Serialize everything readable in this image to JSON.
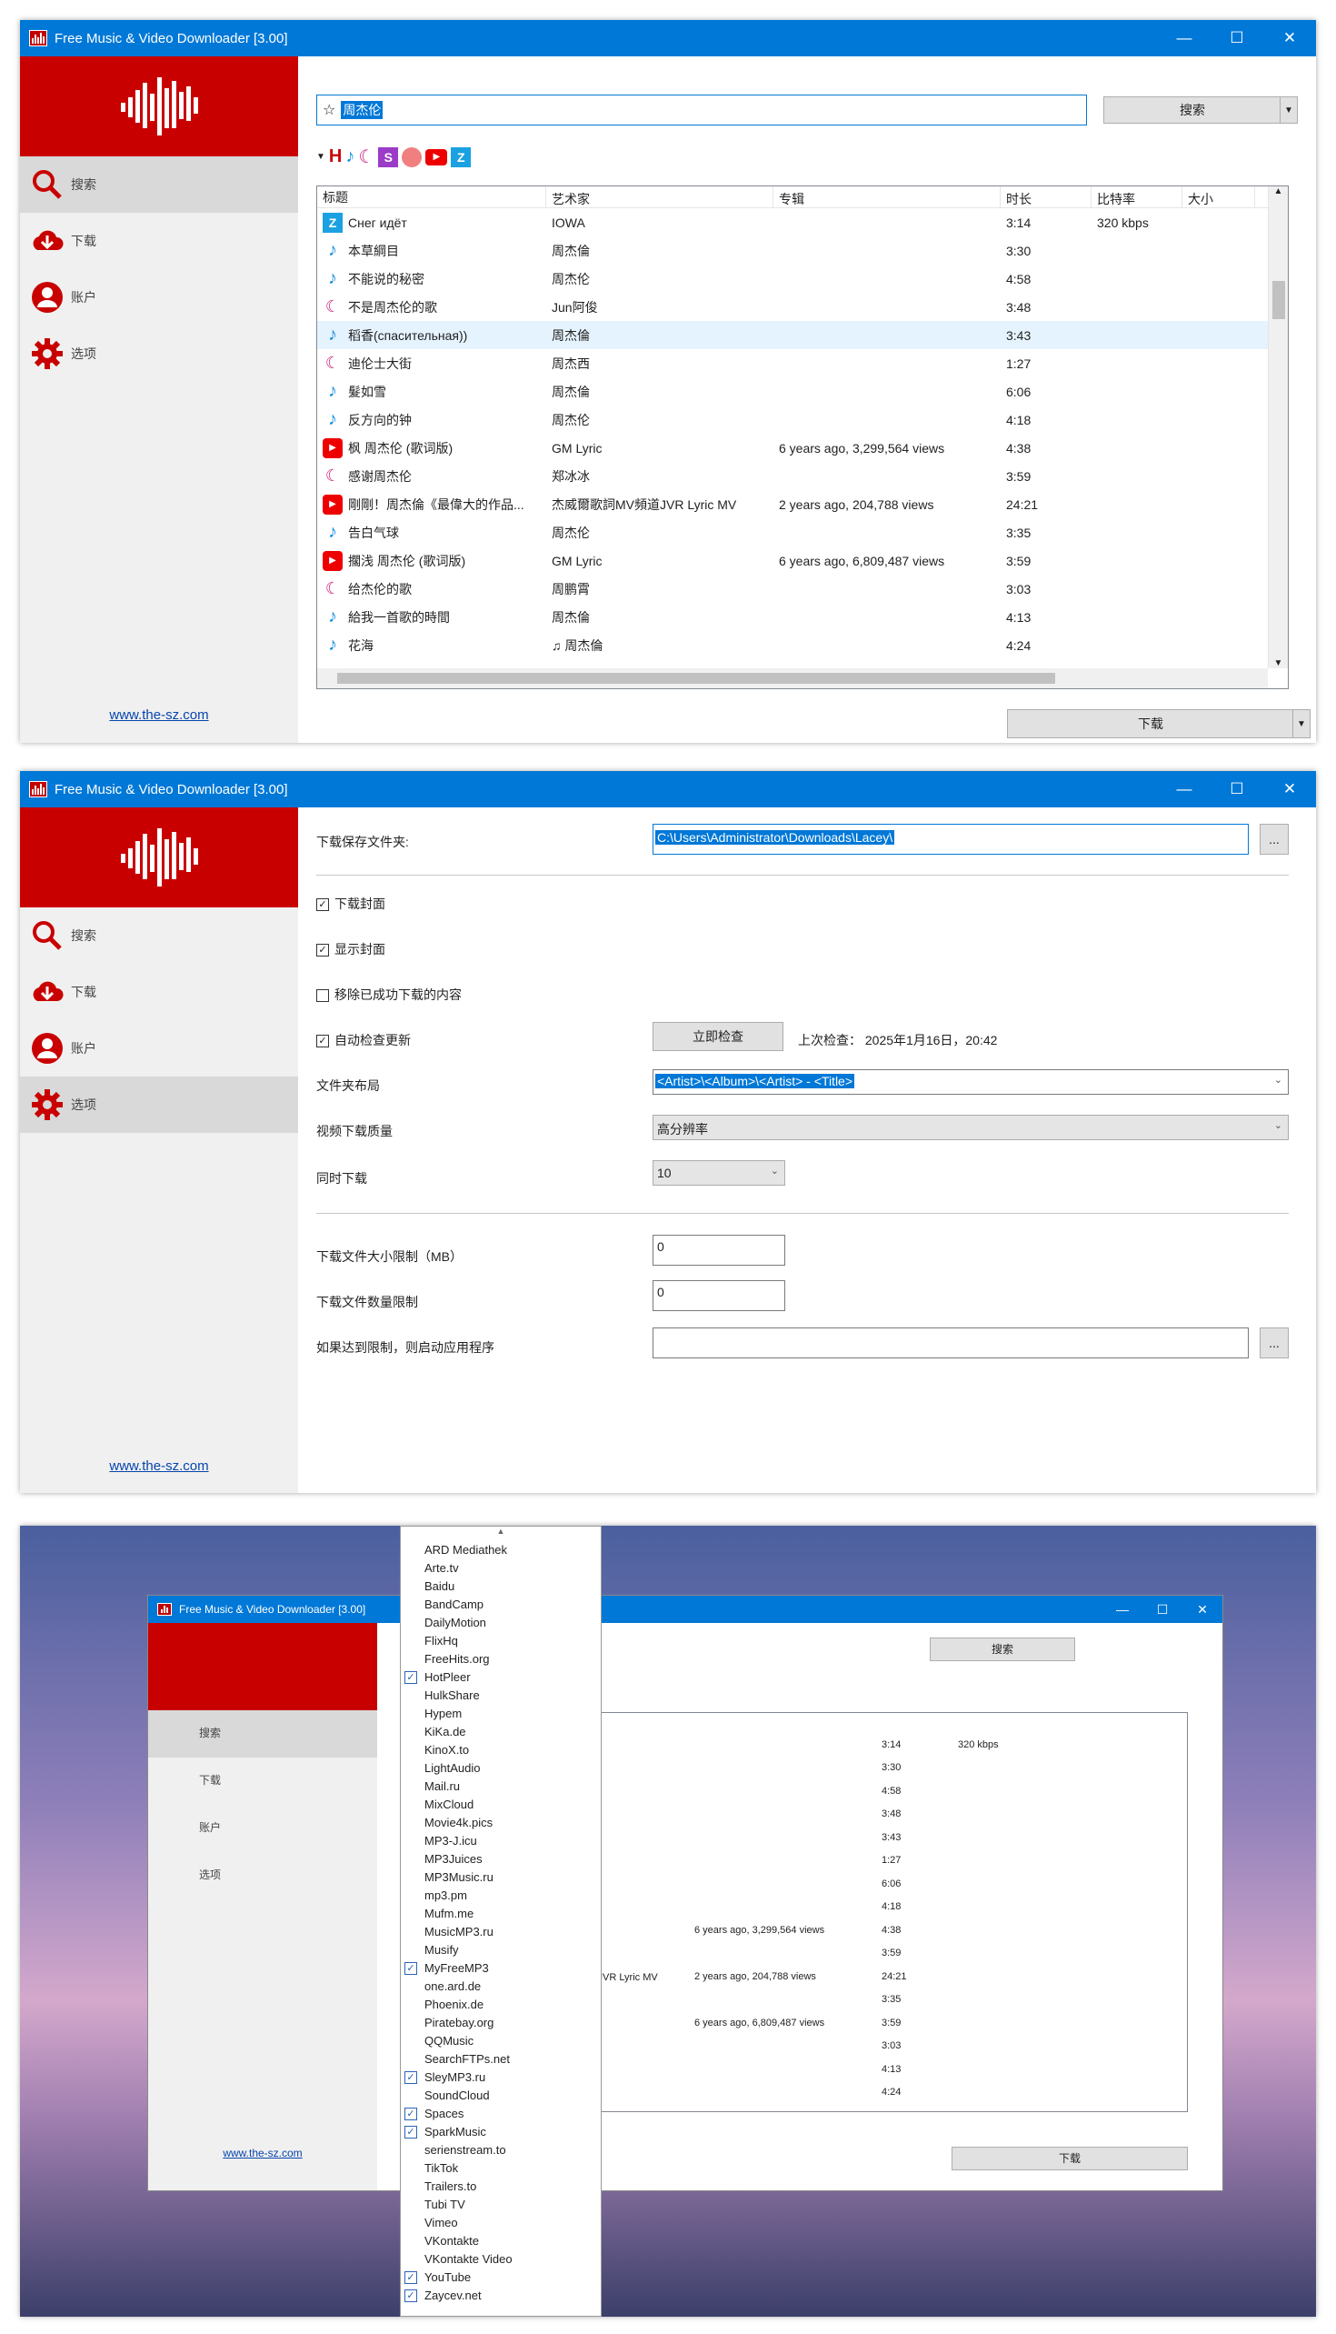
{
  "app": {
    "title": "Free Music & Video Downloader [3.00]",
    "site_link": "www.the-sz.com"
  },
  "nav": [
    {
      "label": "搜索",
      "icon": "search-icon"
    },
    {
      "label": "下载",
      "icon": "cloud-download-icon"
    },
    {
      "label": "账户",
      "icon": "account-icon"
    },
    {
      "label": "选项",
      "icon": "gear-icon"
    }
  ],
  "search": {
    "query": "周杰伦",
    "button": "搜索"
  },
  "table": {
    "columns": [
      "标题",
      "艺术家",
      "专辑",
      "时长",
      "比特率",
      "大小"
    ],
    "rows": [
      {
        "src": "Z",
        "title": "Снег идёт",
        "artist": "IOWA",
        "album": "",
        "dur": "3:14",
        "bitrate": "320 kbps"
      },
      {
        "src": "note",
        "title": "本草綱目",
        "artist": "周杰倫",
        "album": "",
        "dur": "3:30",
        "bitrate": ""
      },
      {
        "src": "note",
        "title": "不能说的秘密",
        "artist": "周杰伦",
        "album": "",
        "dur": "4:58",
        "bitrate": ""
      },
      {
        "src": "c",
        "title": "不是周杰伦的歌",
        "artist": "Jun阿俊",
        "album": "",
        "dur": "3:48",
        "bitrate": ""
      },
      {
        "src": "note",
        "title": "稻香(спасительная))",
        "artist": "周杰倫",
        "album": "",
        "dur": "3:43",
        "bitrate": ""
      },
      {
        "src": "c",
        "title": "迪伦士大街",
        "artist": "周杰西",
        "album": "",
        "dur": "1:27",
        "bitrate": ""
      },
      {
        "src": "note",
        "title": "髮如雪",
        "artist": "周杰倫",
        "album": "",
        "dur": "6:06",
        "bitrate": ""
      },
      {
        "src": "note",
        "title": "反方向的钟",
        "artist": "周杰伦",
        "album": "",
        "dur": "4:18",
        "bitrate": ""
      },
      {
        "src": "yt",
        "title": "枫 周杰伦 (歌词版)",
        "artist": "GM Lyric",
        "album": "6 years ago, 3,299,564 views",
        "dur": "4:38",
        "bitrate": ""
      },
      {
        "src": "c",
        "title": "感谢周杰伦",
        "artist": "郑冰冰",
        "album": "",
        "dur": "3:59",
        "bitrate": ""
      },
      {
        "src": "yt",
        "title": "剛剛！周杰倫《最偉大的作品...",
        "artist": "杰威爾歌詞MV頻道JVR Lyric MV",
        "album": "2 years ago, 204,788 views",
        "dur": "24:21",
        "bitrate": ""
      },
      {
        "src": "note",
        "title": "告白气球",
        "artist": "周杰伦",
        "album": "",
        "dur": "3:35",
        "bitrate": ""
      },
      {
        "src": "yt",
        "title": "擱浅 周杰伦 (歌词版)",
        "artist": "GM Lyric",
        "album": "6 years ago, 6,809,487 views",
        "dur": "3:59",
        "bitrate": ""
      },
      {
        "src": "c",
        "title": "给杰伦的歌",
        "artist": "周鹏霄",
        "album": "",
        "dur": "3:03",
        "bitrate": ""
      },
      {
        "src": "note",
        "title": "給我一首歌的時間",
        "artist": "周杰倫",
        "album": "",
        "dur": "4:13",
        "bitrate": ""
      },
      {
        "src": "note",
        "title": "花海",
        "artist": "♫ 周杰倫",
        "album": "",
        "dur": "4:24",
        "bitrate": ""
      }
    ]
  },
  "download_button": "下载",
  "options": {
    "folder_label": "下载保存文件夹:",
    "folder_value": "C:\\Users\\Administrator\\Downloads\\Lacey\\",
    "browse": "...",
    "download_cover": "下载封面",
    "show_cover": "显示封面",
    "remove_done": "移除已成功下载的内容",
    "auto_update": "自动检查更新",
    "check_now": "立即检查",
    "last_check": "上次检查： 2025年1月16日，20:42",
    "layout_label": "文件夹布局",
    "layout_value": "<Artist>\\<Album>\\<Artist> - <Title>",
    "video_quality_label": "视频下载质量",
    "video_quality_value": "高分辨率",
    "concurrent_label": "同时下载",
    "concurrent_value": "10",
    "size_limit_label": "下载文件大小限制（MB）",
    "size_limit_value": "0",
    "count_limit_label": "下载文件数量限制",
    "count_limit_value": "0",
    "launch_label": "如果达到限制，则启动应用程序",
    "launch_value": ""
  },
  "sources": [
    {
      "name": "ARD Mediathek",
      "checked": false
    },
    {
      "name": "Arte.tv",
      "checked": false
    },
    {
      "name": "Baidu",
      "checked": false
    },
    {
      "name": "BandCamp",
      "checked": false
    },
    {
      "name": "DailyMotion",
      "checked": false
    },
    {
      "name": "FlixHq",
      "checked": false
    },
    {
      "name": "FreeHits.org",
      "checked": false
    },
    {
      "name": "HotPleer",
      "checked": true
    },
    {
      "name": "HulkShare",
      "checked": false
    },
    {
      "name": "Hypem",
      "checked": false
    },
    {
      "name": "KiKa.de",
      "checked": false
    },
    {
      "name": "KinoX.to",
      "checked": false
    },
    {
      "name": "LightAudio",
      "checked": false
    },
    {
      "name": "Mail.ru",
      "checked": false
    },
    {
      "name": "MixCloud",
      "checked": false
    },
    {
      "name": "Movie4k.pics",
      "checked": false
    },
    {
      "name": "MP3-J.icu",
      "checked": false
    },
    {
      "name": "MP3Juices",
      "checked": false
    },
    {
      "name": "MP3Music.ru",
      "checked": false
    },
    {
      "name": "mp3.pm",
      "checked": false
    },
    {
      "name": "Mufm.me",
      "checked": false
    },
    {
      "name": "MusicMP3.ru",
      "checked": false
    },
    {
      "name": "Musify",
      "checked": false
    },
    {
      "name": "MyFreeMP3",
      "checked": true
    },
    {
      "name": "one.ard.de",
      "checked": false
    },
    {
      "name": "Phoenix.de",
      "checked": false
    },
    {
      "name": "Piratebay.org",
      "checked": false
    },
    {
      "name": "QQMusic",
      "checked": false
    },
    {
      "name": "SearchFTPs.net",
      "checked": false
    },
    {
      "name": "SleyMP3.ru",
      "checked": true
    },
    {
      "name": "SoundCloud",
      "checked": false
    },
    {
      "name": "Spaces",
      "checked": true
    },
    {
      "name": "SparkMusic",
      "checked": true
    },
    {
      "name": "serienstream.to",
      "checked": false
    },
    {
      "name": "TikTok",
      "checked": false
    },
    {
      "name": "Trailers.to",
      "checked": false
    },
    {
      "name": "Tubi TV",
      "checked": false
    },
    {
      "name": "Vimeo",
      "checked": false
    },
    {
      "name": "VKontakte",
      "checked": false
    },
    {
      "name": "VKontakte Video",
      "checked": false
    },
    {
      "name": "YouTube",
      "checked": true
    },
    {
      "name": "Zaycev.net",
      "checked": true
    }
  ],
  "colors": {
    "brand": "#c90000",
    "titlebar": "#0078d7",
    "selection": "#0078d7"
  }
}
